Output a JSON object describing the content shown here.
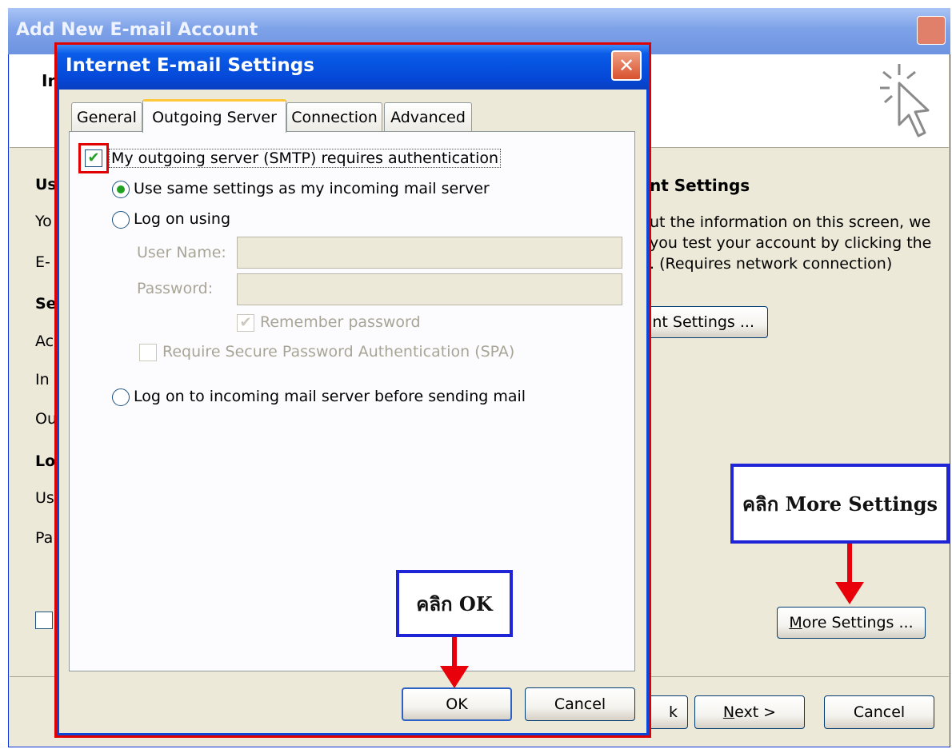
{
  "background_window": {
    "title": "Add New E-mail Account",
    "heading_partial": "In",
    "left_labels": [
      {
        "text": "Us",
        "bold": true
      },
      {
        "text": "Yo",
        "bold": false
      },
      {
        "text": "E-",
        "bold": false
      },
      {
        "text": "Se",
        "bold": true
      },
      {
        "text": "Ac",
        "bold": false
      },
      {
        "text": "In",
        "bold": false
      },
      {
        "text": "Ou",
        "bold": false
      },
      {
        "text": "Lo",
        "bold": true
      },
      {
        "text": "Us",
        "bold": false
      },
      {
        "text": "Pa",
        "bold": false
      }
    ],
    "test_heading_partial": "nt Settings",
    "test_description_lines": [
      "ut the information on this screen, we",
      "you test your account by clicking the",
      ". (Requires network connection)"
    ],
    "test_button_partial": "nt Settings ...",
    "more_settings_button": "More Settings ...",
    "back_button_partial": "k",
    "next_button": "Next >",
    "cancel_button": "Cancel"
  },
  "annotations": {
    "more_settings": "คลิก More Settings",
    "ok": "คลิก OK"
  },
  "dialog": {
    "title": "Internet E-mail Settings",
    "close_glyph": "✕",
    "tabs": [
      "General",
      "Outgoing Server",
      "Connection",
      "Advanced"
    ],
    "active_tab": "Outgoing Server",
    "auth_checkbox": {
      "label": "My outgoing server (SMTP) requires authentication",
      "checked": true
    },
    "radio_same_settings": {
      "label": "Use same settings as my incoming mail server",
      "selected": true
    },
    "radio_log_on_using": {
      "label": "Log on using",
      "selected": false
    },
    "user_name_label": "User Name:",
    "user_name_value": "",
    "password_label": "Password:",
    "password_value": "",
    "remember_password": {
      "label": "Remember password",
      "checked": true
    },
    "spa": {
      "label": "Require Secure Password Authentication (SPA)",
      "checked": false
    },
    "radio_log_on_before": {
      "label": "Log on to incoming mail server before sending mail",
      "selected": false
    },
    "ok_button": "OK",
    "cancel_button": "Cancel",
    "check_glyph": "✔"
  },
  "colors": {
    "dialog_highlight_border": "#e00000",
    "annotation_border": "#1f24d6",
    "arrow": "#e8000b",
    "check_green": "#21a121"
  }
}
